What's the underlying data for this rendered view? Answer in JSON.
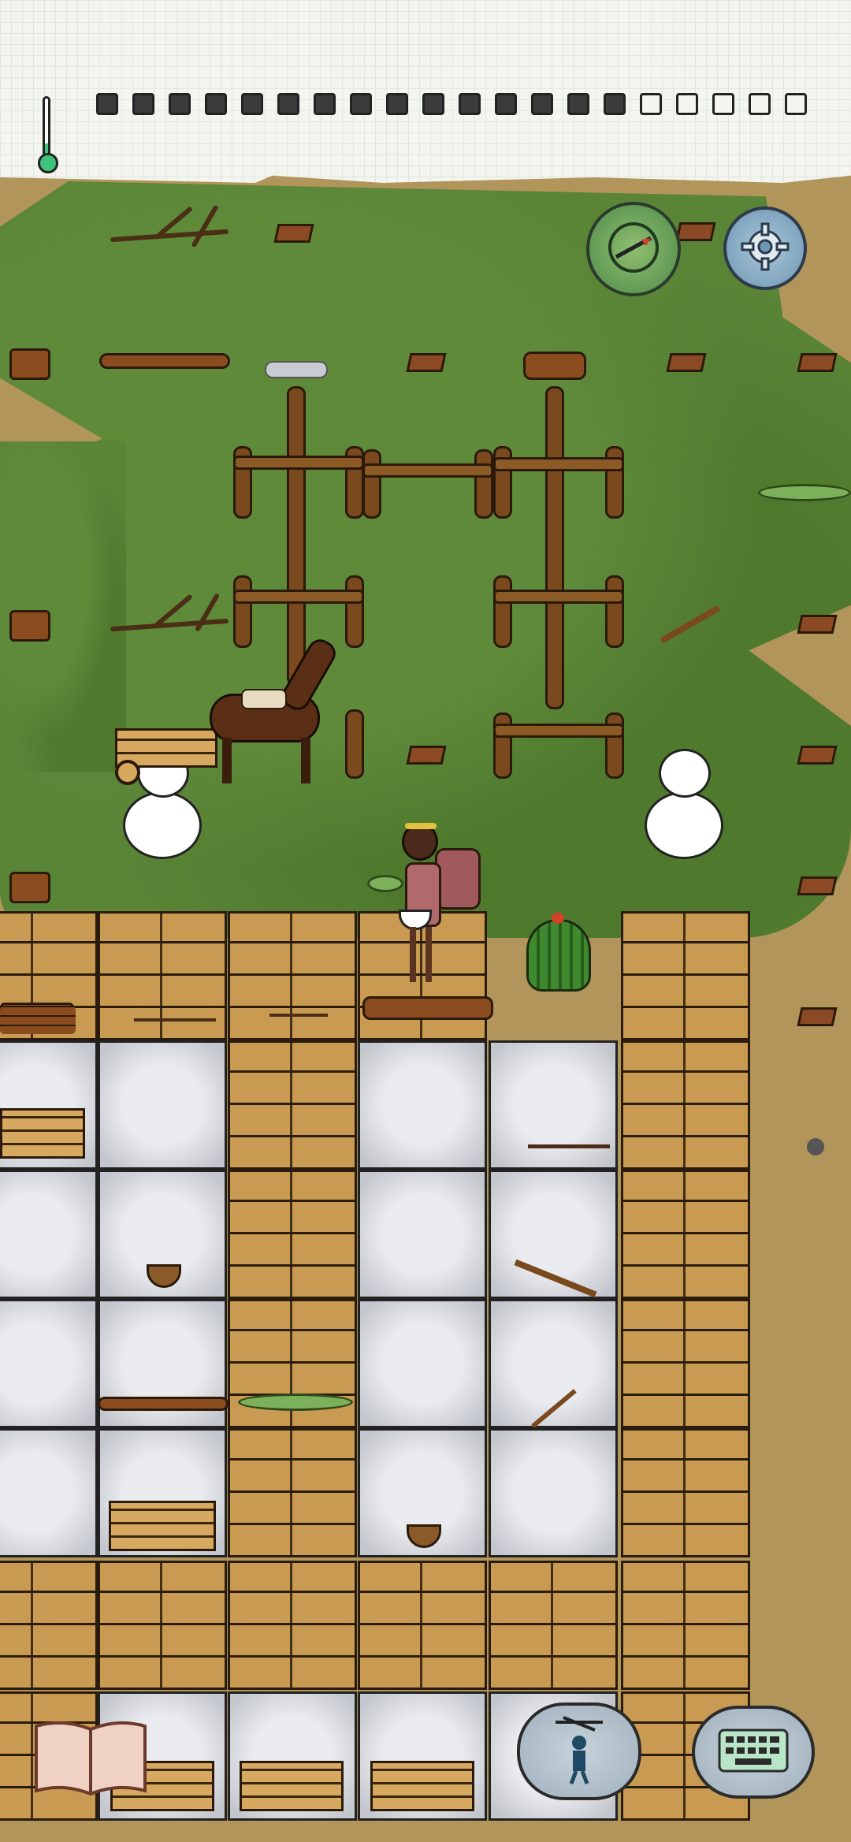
{
  "hud": {
    "temperature_level": 0.2,
    "food_pips_total": 20,
    "food_pips_filled": 15,
    "thermometer_color": "#3fc27a"
  },
  "buttons": {
    "compass_icon": "compass-icon",
    "settings_icon": "gear-icon",
    "emote_icon": "puppet-icon",
    "keyboard_icon": "keyboard-icon",
    "book_icon": "recipe-book-icon"
  },
  "colors": {
    "grass": "#5a8436",
    "dirt": "#b2955a",
    "wood_floor": "#c99a52",
    "stone_floor": "#d8dbe0"
  }
}
